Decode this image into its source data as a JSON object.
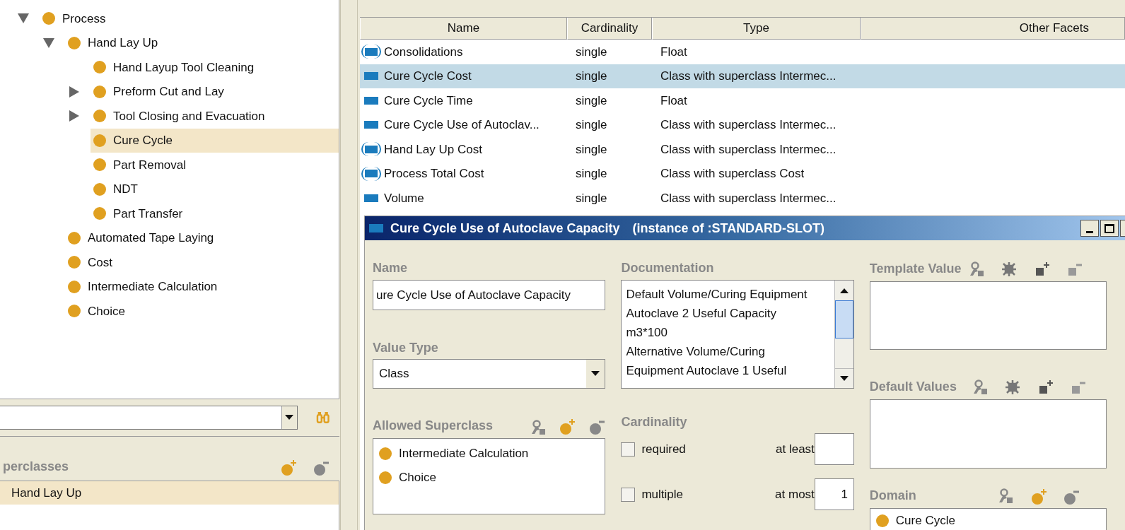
{
  "class_tree": [
    {
      "label": "Process",
      "expanded": true,
      "selected": false,
      "children": [
        {
          "label": "Hand Lay Up",
          "expanded": true,
          "selected": false,
          "children": [
            {
              "label": "Hand Layup Tool Cleaning",
              "selected": false
            },
            {
              "label": "Preform Cut and Lay",
              "expanded": false,
              "selected": false
            },
            {
              "label": "Tool Closing and Evacuation",
              "expanded": false,
              "selected": false
            },
            {
              "label": "Cure Cycle",
              "selected": true
            },
            {
              "label": "Part Removal",
              "selected": false
            },
            {
              "label": "NDT",
              "selected": false
            },
            {
              "label": "Part Transfer",
              "selected": false
            }
          ]
        },
        {
          "label": "Automated Tape Laying",
          "selected": false
        },
        {
          "label": "Cost",
          "selected": false
        },
        {
          "label": "Intermediate Calculation",
          "selected": false
        },
        {
          "label": "Choice",
          "selected": false
        }
      ]
    }
  ],
  "superclasses": {
    "title": "perclasses",
    "items": [
      {
        "label": "Hand Lay Up",
        "selected": true
      }
    ]
  },
  "slots_table": {
    "columns": [
      "Name",
      "Cardinality",
      "Type",
      "Other Facets"
    ],
    "rows": [
      {
        "kind": "inherited",
        "name": "Consolidations",
        "cardinality": "single",
        "type": "Float",
        "selected": false
      },
      {
        "kind": "direct",
        "name": "Cure Cycle Cost",
        "cardinality": "single",
        "type": "Class with superclass Intermec...",
        "selected": true
      },
      {
        "kind": "direct",
        "name": "Cure Cycle Time",
        "cardinality": "single",
        "type": "Float",
        "selected": false
      },
      {
        "kind": "direct",
        "name": "Cure Cycle Use of Autoclav...",
        "cardinality": "single",
        "type": "Class with superclass Intermec...",
        "selected": false
      },
      {
        "kind": "inherited",
        "name": "Hand Lay Up Cost",
        "cardinality": "single",
        "type": "Class with superclass Intermec...",
        "selected": false
      },
      {
        "kind": "inherited",
        "name": "Process Total Cost",
        "cardinality": "single",
        "type": "Class with superclass Cost",
        "selected": false
      },
      {
        "kind": "direct",
        "name": "Volume",
        "cardinality": "single",
        "type": "Class with superclass Intermec...",
        "selected": false
      }
    ]
  },
  "slot_window": {
    "title": "Cure Cycle Use of Autoclave Capacity",
    "subtitle": "(instance of :STANDARD-SLOT)",
    "name": {
      "label": "Name",
      "value": "ure Cycle Use of Autoclave Capacity"
    },
    "value_type": {
      "label": "Value Type",
      "value": "Class"
    },
    "allowed_superclasses": {
      "label": "Allowed Superclass",
      "items": [
        "Intermediate Calculation",
        "Choice"
      ]
    },
    "documentation": {
      "label": "Documentation",
      "lines": [
        "Default Volume/Curing Equipment",
        "Autoclave 2 Useful Capacity",
        "m3*100",
        "Alternative Volume/Curing",
        "Equipment Autoclave 1 Useful"
      ]
    },
    "cardinality": {
      "label": "Cardinality",
      "required": {
        "label": "required",
        "checked": false
      },
      "multiple": {
        "label": "multiple",
        "checked": false
      },
      "at_least": {
        "label": "at least"
      },
      "at_most": {
        "label": "at most",
        "value": "1"
      }
    },
    "template_value": {
      "label": "Template Value"
    },
    "default_values": {
      "label": "Default Values"
    },
    "domain": {
      "label": "Domain",
      "items": [
        "Cure Cycle"
      ]
    }
  }
}
